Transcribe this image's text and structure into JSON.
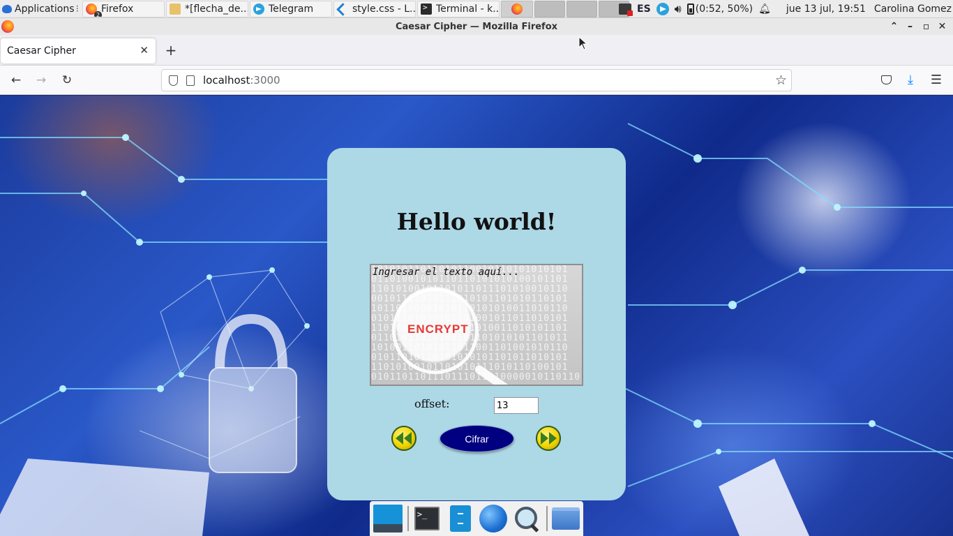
{
  "panel": {
    "apps_menu_label": "Applications",
    "tasks": [
      {
        "label": "Firefox",
        "icon": "firefox-icon",
        "badge": "2"
      },
      {
        "label": "*[flecha_de...",
        "icon": "image-icon"
      },
      {
        "label": "Telegram",
        "icon": "telegram-icon"
      },
      {
        "label": "style.css - L...",
        "icon": "vscode-icon"
      },
      {
        "label": "Terminal - k...",
        "icon": "terminal-icon"
      }
    ],
    "tray": {
      "keyboard_layout": "ES",
      "battery": "(0:52, 50%)",
      "datetime": "jue 13 jul, 19:51",
      "user": "Carolina Gomez"
    }
  },
  "window": {
    "title": "Caesar Cipher — Mozilla Firefox"
  },
  "browser": {
    "tab_title": "Caesar Cipher",
    "url_host": "localhost",
    "url_port": ":3000"
  },
  "page": {
    "heading": "Hello world!",
    "textarea_placeholder": "Ingresar el texto aquí...",
    "textarea_image_text": "ENCRYPT",
    "offset_label": "offset:",
    "offset_value": "13",
    "cipher_button": "Cifrar",
    "colors": {
      "card_bg": "#add8e6",
      "button_bg": "#000080",
      "arrow_yellow": "#f2d400"
    }
  },
  "dock": {
    "items": [
      "desktop-icon",
      "terminal-icon",
      "file-manager-icon",
      "web-browser-icon",
      "search-icon",
      "folder-icon"
    ]
  }
}
